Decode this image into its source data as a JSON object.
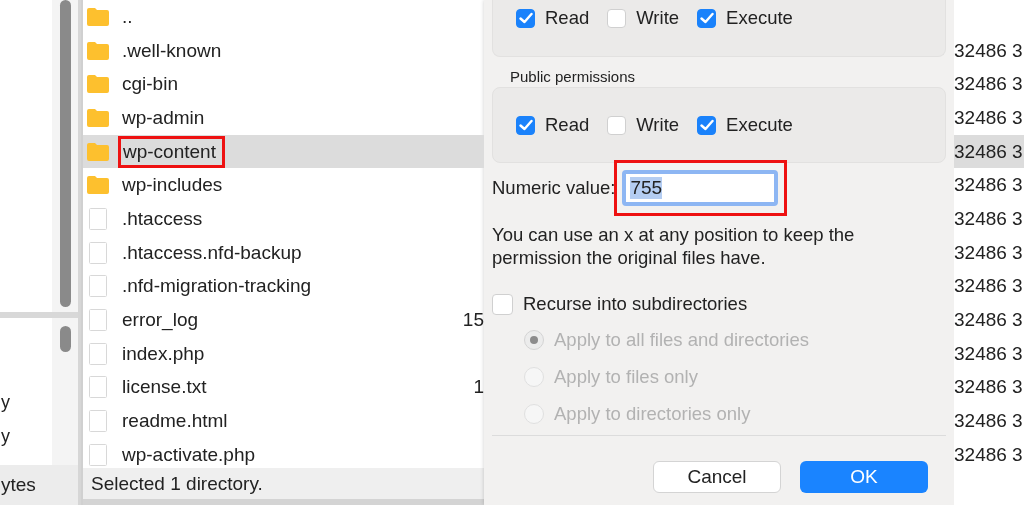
{
  "left_pane": {
    "texts": [
      "y",
      "y"
    ],
    "status": "ytes"
  },
  "file_list": {
    "rows": [
      {
        "name": "..",
        "kind": "folder",
        "selected": false,
        "annotated": false
      },
      {
        "name": ".well-known",
        "kind": "folder",
        "selected": false,
        "annotated": false,
        "column_3": "32486 3"
      },
      {
        "name": "cgi-bin",
        "kind": "folder",
        "selected": false,
        "annotated": false,
        "column_3": "32486 3"
      },
      {
        "name": "wp-admin",
        "kind": "folder",
        "selected": false,
        "annotated": false,
        "column_3": "32486 3"
      },
      {
        "name": "wp-content",
        "kind": "folder",
        "selected": true,
        "annotated": true,
        "column_3": "32486 3"
      },
      {
        "name": "wp-includes",
        "kind": "folder",
        "selected": false,
        "annotated": false,
        "column_3": "32486 3"
      },
      {
        "name": ".htaccess",
        "kind": "file",
        "selected": false,
        "annotated": false,
        "column_3": "32486 3"
      },
      {
        "name": ".htaccess.nfd-backup",
        "kind": "file",
        "selected": false,
        "annotated": false,
        "column_3": "32486 3"
      },
      {
        "name": ".nfd-migration-tracking",
        "kind": "file",
        "selected": false,
        "annotated": false,
        "column_3": "32486 3"
      },
      {
        "name": "error_log",
        "kind": "file",
        "selected": false,
        "annotated": false,
        "size": "15",
        "column_3": "32486 3"
      },
      {
        "name": "index.php",
        "kind": "file",
        "selected": false,
        "annotated": false,
        "column_3": "32486 3"
      },
      {
        "name": "license.txt",
        "kind": "file",
        "selected": false,
        "annotated": false,
        "size": "1",
        "column_3": "32486 3"
      },
      {
        "name": "readme.html",
        "kind": "file",
        "selected": false,
        "annotated": false,
        "column_3": "32486 3"
      },
      {
        "name": "wp-activate.php",
        "kind": "file",
        "selected": false,
        "annotated": false,
        "column_3": "32486 3"
      }
    ]
  },
  "status_bar": "Selected 1 directory.",
  "dialog": {
    "groups": [
      {
        "permissions": [
          {
            "label": "Read",
            "checked": true
          },
          {
            "label": "Write",
            "checked": false
          },
          {
            "label": "Execute",
            "checked": true
          }
        ]
      },
      {
        "title": "Public permissions",
        "permissions": [
          {
            "label": "Read",
            "checked": true
          },
          {
            "label": "Write",
            "checked": false
          },
          {
            "label": "Execute",
            "checked": true
          }
        ]
      }
    ],
    "numeric": {
      "label": "Numeric value:",
      "value": "755",
      "value_selected": true,
      "annotated": true
    },
    "hint": "You can use an x at any position to keep the permission the original files have.",
    "recurse": {
      "label": "Recurse into subdirectories",
      "checked": false
    },
    "apply_options": [
      {
        "label": "Apply to all files and directories",
        "selected": true,
        "disabled": true
      },
      {
        "label": "Apply to files only",
        "selected": false,
        "disabled": true
      },
      {
        "label": "Apply to directories only",
        "selected": false,
        "disabled": true
      }
    ],
    "buttons": [
      {
        "label": "Cancel",
        "kind": "default"
      },
      {
        "label": "OK",
        "kind": "primary"
      }
    ]
  }
}
